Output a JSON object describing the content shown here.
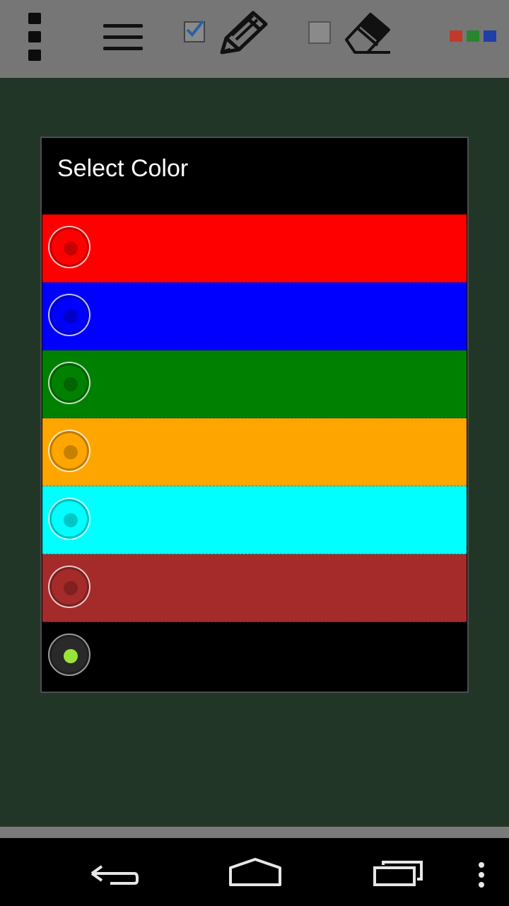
{
  "toolbar": {
    "menu_icon": "overflow-vertical-icon",
    "list_icon": "hamburger-icon",
    "pencil_checked": true,
    "pencil_icon": "pencil-icon",
    "eraser_checked": false,
    "eraser_icon": "eraser-icon",
    "swatch_colors": [
      "#c0392b",
      "#27862f",
      "#1f3ea8"
    ]
  },
  "dialog": {
    "title": "Select Color",
    "options": [
      {
        "color": "#ff0000",
        "selected": false
      },
      {
        "color": "#0000ff",
        "selected": false
      },
      {
        "color": "#008000",
        "selected": false
      },
      {
        "color": "#ffa500",
        "selected": false
      },
      {
        "color": "#00ffff",
        "selected": false
      },
      {
        "color": "#a52a2a",
        "selected": false
      },
      {
        "color": "#000000",
        "selected": true
      }
    ]
  },
  "navbar": {
    "back_icon": "back-icon",
    "home_icon": "home-icon",
    "recents_icon": "recents-icon",
    "menu_icon": "overflow-menu-icon"
  }
}
